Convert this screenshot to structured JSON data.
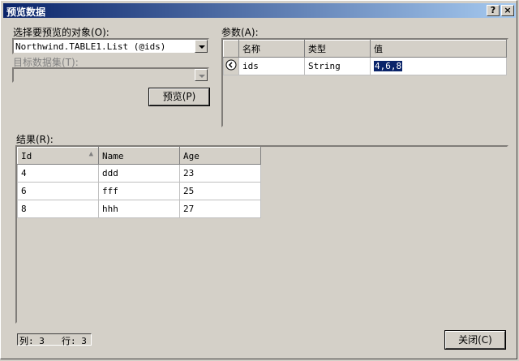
{
  "window": {
    "title": "预览数据",
    "help_label": "?",
    "close_label": "×"
  },
  "left": {
    "select_label": "选择要预览的对象(O):",
    "select_value": "Northwind.TABLE1.List (@ids)",
    "dataset_label": "目标数据集(T):",
    "dataset_value": "",
    "preview_button": "预览(P)"
  },
  "params": {
    "label": "参数(A):",
    "columns": [
      "名称",
      "类型",
      "值"
    ],
    "rows": [
      {
        "name": "ids",
        "type": "String",
        "value": "4,6,8"
      }
    ]
  },
  "results": {
    "label": "结果(R):",
    "columns": [
      "Id",
      "Name",
      "Age"
    ],
    "rows": [
      [
        "4",
        "ddd",
        "23"
      ],
      [
        "6",
        "fff",
        "25"
      ],
      [
        "8",
        "hhh",
        "27"
      ]
    ]
  },
  "status": {
    "cols": "列: 3",
    "rows": "行: 3"
  },
  "footer": {
    "close_button": "关闭(C)"
  }
}
